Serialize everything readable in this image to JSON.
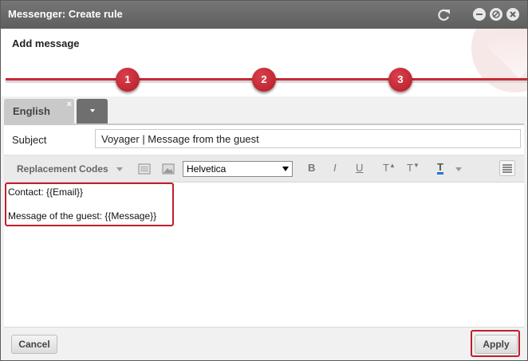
{
  "window": {
    "title": "Messenger: Create rule"
  },
  "header": {
    "title": "Add message",
    "steps": [
      "1",
      "2",
      "3"
    ]
  },
  "tabs": {
    "language": "English",
    "close_glyph": "×"
  },
  "subject": {
    "label": "Subject",
    "value": "Voyager | Message from the guest"
  },
  "toolbar": {
    "replacement_codes": "Replacement Codes",
    "font": "Helvetica",
    "bold": "B",
    "italic": "I",
    "underline": "U",
    "superscript": "T",
    "subscript": "T",
    "text_color": "T",
    "accent_color": "#1e7ad0"
  },
  "editor": {
    "lines": [
      "Contact: {{Email}}",
      "Message of the guest: {{Message}}"
    ],
    "highlight_color": "#c01e2b"
  },
  "footer": {
    "cancel": "Cancel",
    "apply": "Apply"
  },
  "icons": [
    "refresh-icon",
    "minimize-icon",
    "restore-icon",
    "close-icon",
    "list-icon",
    "image-icon",
    "align-icon"
  ],
  "colors": {
    "brand_red": "#c82a35",
    "titlebar": "#6a6a6a"
  }
}
